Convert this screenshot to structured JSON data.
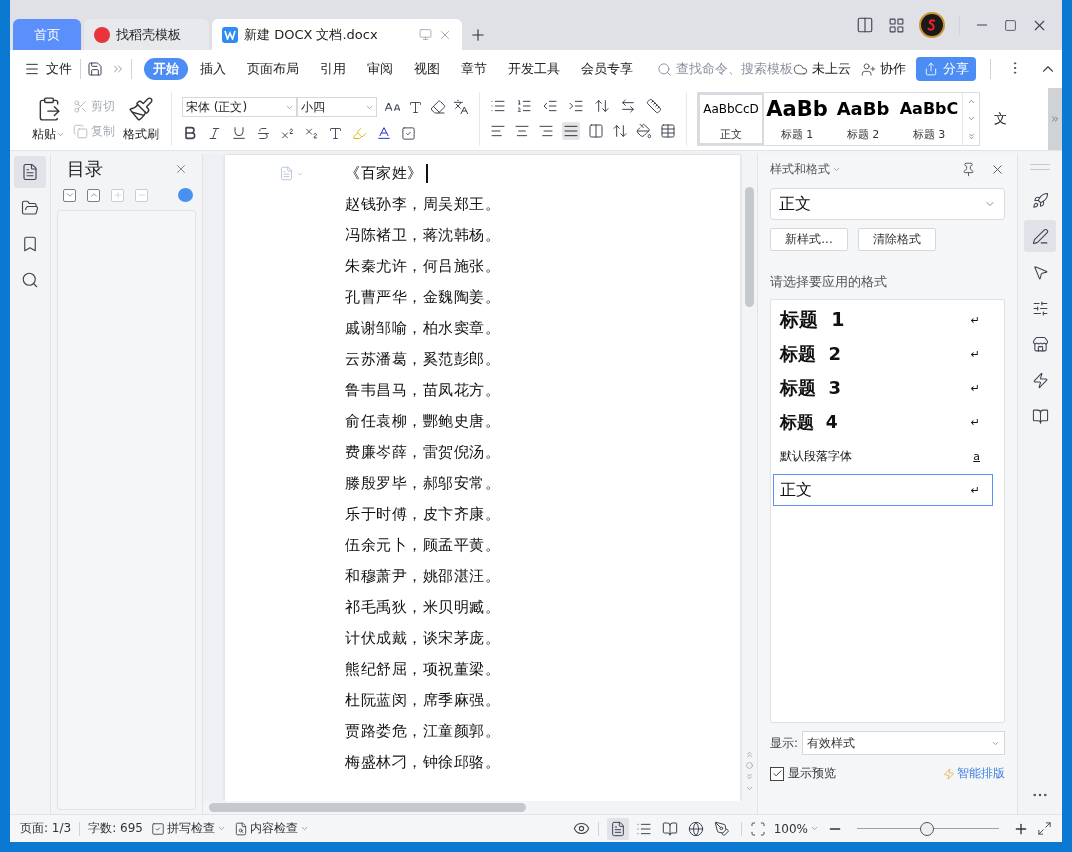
{
  "tabs": [
    {
      "label": "首页",
      "kind": "home",
      "selected": false
    },
    {
      "label": "找稻壳模板",
      "kind": "docer",
      "selected": false
    },
    {
      "label": "新建 DOCX 文档.docx",
      "kind": "document",
      "selected": true
    }
  ],
  "menu": {
    "file": "文件",
    "ribbon_tabs": [
      {
        "label": "开始",
        "selected": true
      },
      {
        "label": "插入",
        "selected": false
      },
      {
        "label": "页面布局",
        "selected": false
      },
      {
        "label": "引用",
        "selected": false
      },
      {
        "label": "审阅",
        "selected": false
      },
      {
        "label": "视图",
        "selected": false
      },
      {
        "label": "章节",
        "selected": false
      },
      {
        "label": "开发工具",
        "selected": false
      },
      {
        "label": "会员专享",
        "selected": false
      }
    ],
    "search": {
      "placeholder": "查找命令、搜索模板"
    },
    "cloud": "未上云",
    "collab": "协作",
    "share": "分享"
  },
  "ribbon": {
    "paste": "粘贴",
    "cut": {
      "label": "剪切",
      "disabled": true
    },
    "copy": {
      "label": "复制",
      "disabled": true
    },
    "format_painter": "格式刷",
    "font": "宋体 (正文)",
    "size": "小四",
    "styles": [
      {
        "kind": "body",
        "preview": "AaBbCcD",
        "label": "正文",
        "selected": true
      },
      {
        "kind": "h1",
        "preview": "AaBb",
        "label": "标题 1",
        "selected": false
      },
      {
        "kind": "h2",
        "preview": "AaBb",
        "label": "标题 2",
        "selected": false
      },
      {
        "kind": "h3",
        "preview": "AaBbC",
        "label": "标题 3",
        "selected": false
      }
    ],
    "overflow": "文"
  },
  "nav_rail": [
    {
      "kind": "toc",
      "selected": true
    },
    {
      "kind": "chapters",
      "selected": false
    },
    {
      "kind": "bookmark",
      "selected": false
    },
    {
      "kind": "search",
      "selected": false
    }
  ],
  "toc_panel": {
    "title": "目录",
    "tools": [
      {
        "kind": "expand",
        "disabled": false
      },
      {
        "kind": "collapse",
        "disabled": false
      },
      {
        "kind": "add",
        "disabled": true
      },
      {
        "kind": "remove",
        "disabled": true
      }
    ]
  },
  "document": {
    "title": "《百家姓》",
    "lines": [
      "赵钱孙李，周吴郑王。",
      "冯陈褚卫，蒋沈韩杨。",
      "朱秦尤许，何吕施张。",
      "孔曹严华，金魏陶姜。",
      "戚谢邹喻，柏水窦章。",
      "云苏潘葛，奚范彭郎。",
      "鲁韦昌马，苗凤花方。",
      "俞任袁柳，酆鲍史唐。",
      "费廉岑薛，雷贺倪汤。",
      "滕殷罗毕，郝邬安常。",
      "乐于时傅，皮卞齐康。",
      "伍余元卜，顾孟平黄。",
      "和穆萧尹，姚邵湛汪。",
      "祁毛禹狄，米贝明臧。",
      "计伏成戴，谈宋茅庞。",
      "熊纪舒屈，项祝董梁。",
      "杜阮蓝闵，席季麻强。",
      "贾路娄危，江童颜郭。",
      "梅盛林刁，钟徐邱骆。"
    ]
  },
  "styles_panel": {
    "title": "样式和格式",
    "current": "正文",
    "new_style": "新样式...",
    "clear": "清除格式",
    "prompt": "请选择要应用的格式",
    "items": [
      {
        "kind": "h1",
        "label": "标题  1",
        "symbol": "↵",
        "selected": false
      },
      {
        "kind": "h2",
        "label": "标题  2",
        "symbol": "↵",
        "selected": false
      },
      {
        "kind": "h3",
        "label": "标题  3",
        "symbol": "↵",
        "selected": false
      },
      {
        "kind": "h4",
        "label": "标题  4",
        "symbol": "↵",
        "selected": false
      },
      {
        "kind": "char",
        "label": "默认段落字体",
        "symbol": "a",
        "selected": false
      },
      {
        "kind": "body",
        "label": "正文",
        "symbol": "↵",
        "selected": true
      }
    ],
    "show_label": "显示:",
    "show_value": "有效样式",
    "preview": {
      "label": "显示预览",
      "checked": true
    },
    "smart_layout": "智能排版"
  },
  "side_rail": [
    {
      "kind": "rocket",
      "selected": false
    },
    {
      "kind": "pen",
      "selected": true
    },
    {
      "kind": "pointer",
      "selected": false
    },
    {
      "kind": "sliders",
      "selected": false
    },
    {
      "kind": "store",
      "selected": false
    },
    {
      "kind": "bolt",
      "selected": false
    },
    {
      "kind": "book",
      "selected": false
    }
  ],
  "status_bar": {
    "page": "页面: 1/3",
    "words": "字数: 695",
    "spell": "拼写检查",
    "content": "内容检查",
    "views": [
      {
        "kind": "page",
        "selected": true
      },
      {
        "kind": "outline",
        "selected": false
      },
      {
        "kind": "read",
        "selected": false
      },
      {
        "kind": "web",
        "selected": false
      },
      {
        "kind": "write",
        "selected": false
      }
    ],
    "zoom": "100%",
    "zoom_slider": {
      "level": 0.49
    }
  }
}
